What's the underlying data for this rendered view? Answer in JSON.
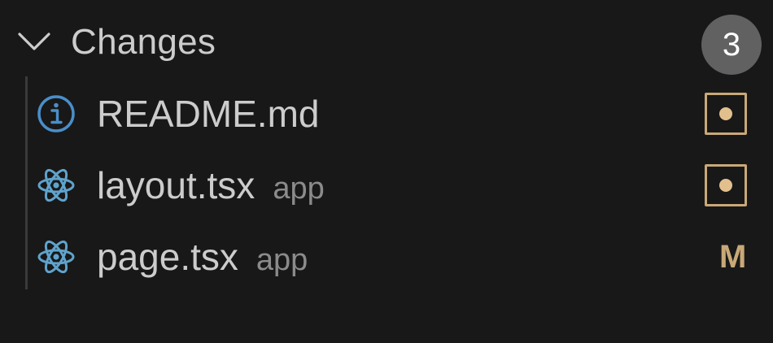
{
  "section": {
    "title": "Changes",
    "count": "3",
    "chevron_icon": "chevron-down-icon"
  },
  "colors": {
    "background": "#181818",
    "text": "#cccccc",
    "muted_text": "#8b8b8b",
    "badge_bg": "#616161",
    "modified": "#c9a878",
    "info_icon": "#4a8ec9",
    "react_icon": "#5fa3cc"
  },
  "files": [
    {
      "name": "README.md",
      "dir": "",
      "icon": "info-icon",
      "status": "unsaved-box"
    },
    {
      "name": "layout.tsx",
      "dir": "app",
      "icon": "react-icon",
      "status": "unsaved-box"
    },
    {
      "name": "page.tsx",
      "dir": "app",
      "icon": "react-icon",
      "status": "M"
    }
  ]
}
